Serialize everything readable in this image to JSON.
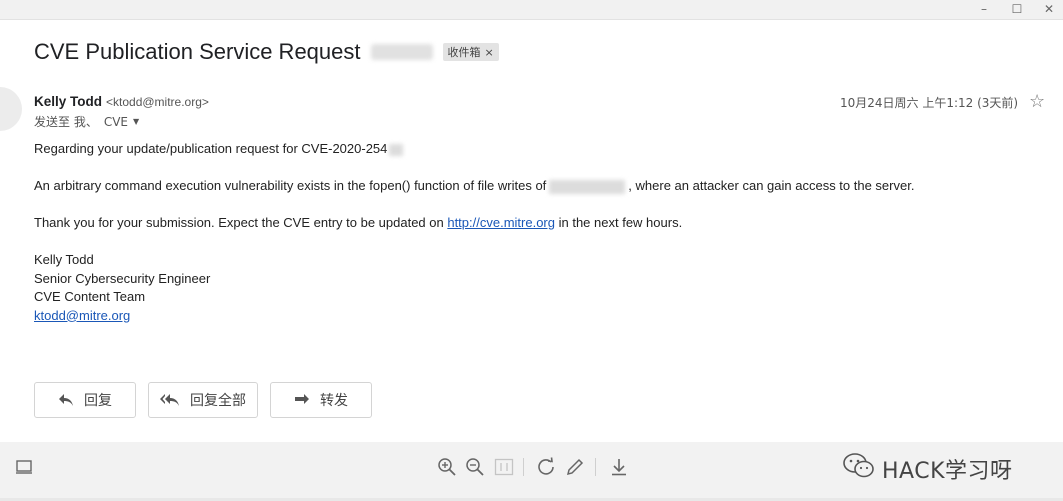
{
  "window": {
    "minimize": "–",
    "maximize": "☐",
    "close": "✕"
  },
  "email": {
    "subject": "CVE Publication Service Request",
    "label": "收件箱",
    "label_remove": "×",
    "sender_name": "Kelly Todd",
    "sender_email": "<ktodd@mitre.org>",
    "date": "10月24日周六 上午1:12 (3天前)",
    "to_prefix": "发送至 我、",
    "to_list": "CVE",
    "body": {
      "line1": "Regarding your update/publication request for CVE-2020-254",
      "line2_a": "An arbitrary command execution vulnerability exists in the fopen() function of file writes of",
      "line2_b": ", where an attacker can gain access to the server.",
      "line3_a": "Thank you for your submission. Expect the CVE entry to be updated on ",
      "line3_link": "http://cve.mitre.org",
      "line3_b": " in the next few hours.",
      "sig_name": "Kelly Todd",
      "sig_title": "Senior Cybersecurity Engineer",
      "sig_team": "CVE Content Team",
      "sig_email": "ktodd@mitre.org"
    }
  },
  "actions": {
    "reply": "回复",
    "reply_all": "回复全部",
    "forward": "转发"
  },
  "watermark": {
    "text": "HACK学习呀"
  },
  "colors": {
    "link": "#1a57b7",
    "toolbar_bg": "#f2f2f2",
    "chip_bg": "#e3e3e3"
  }
}
